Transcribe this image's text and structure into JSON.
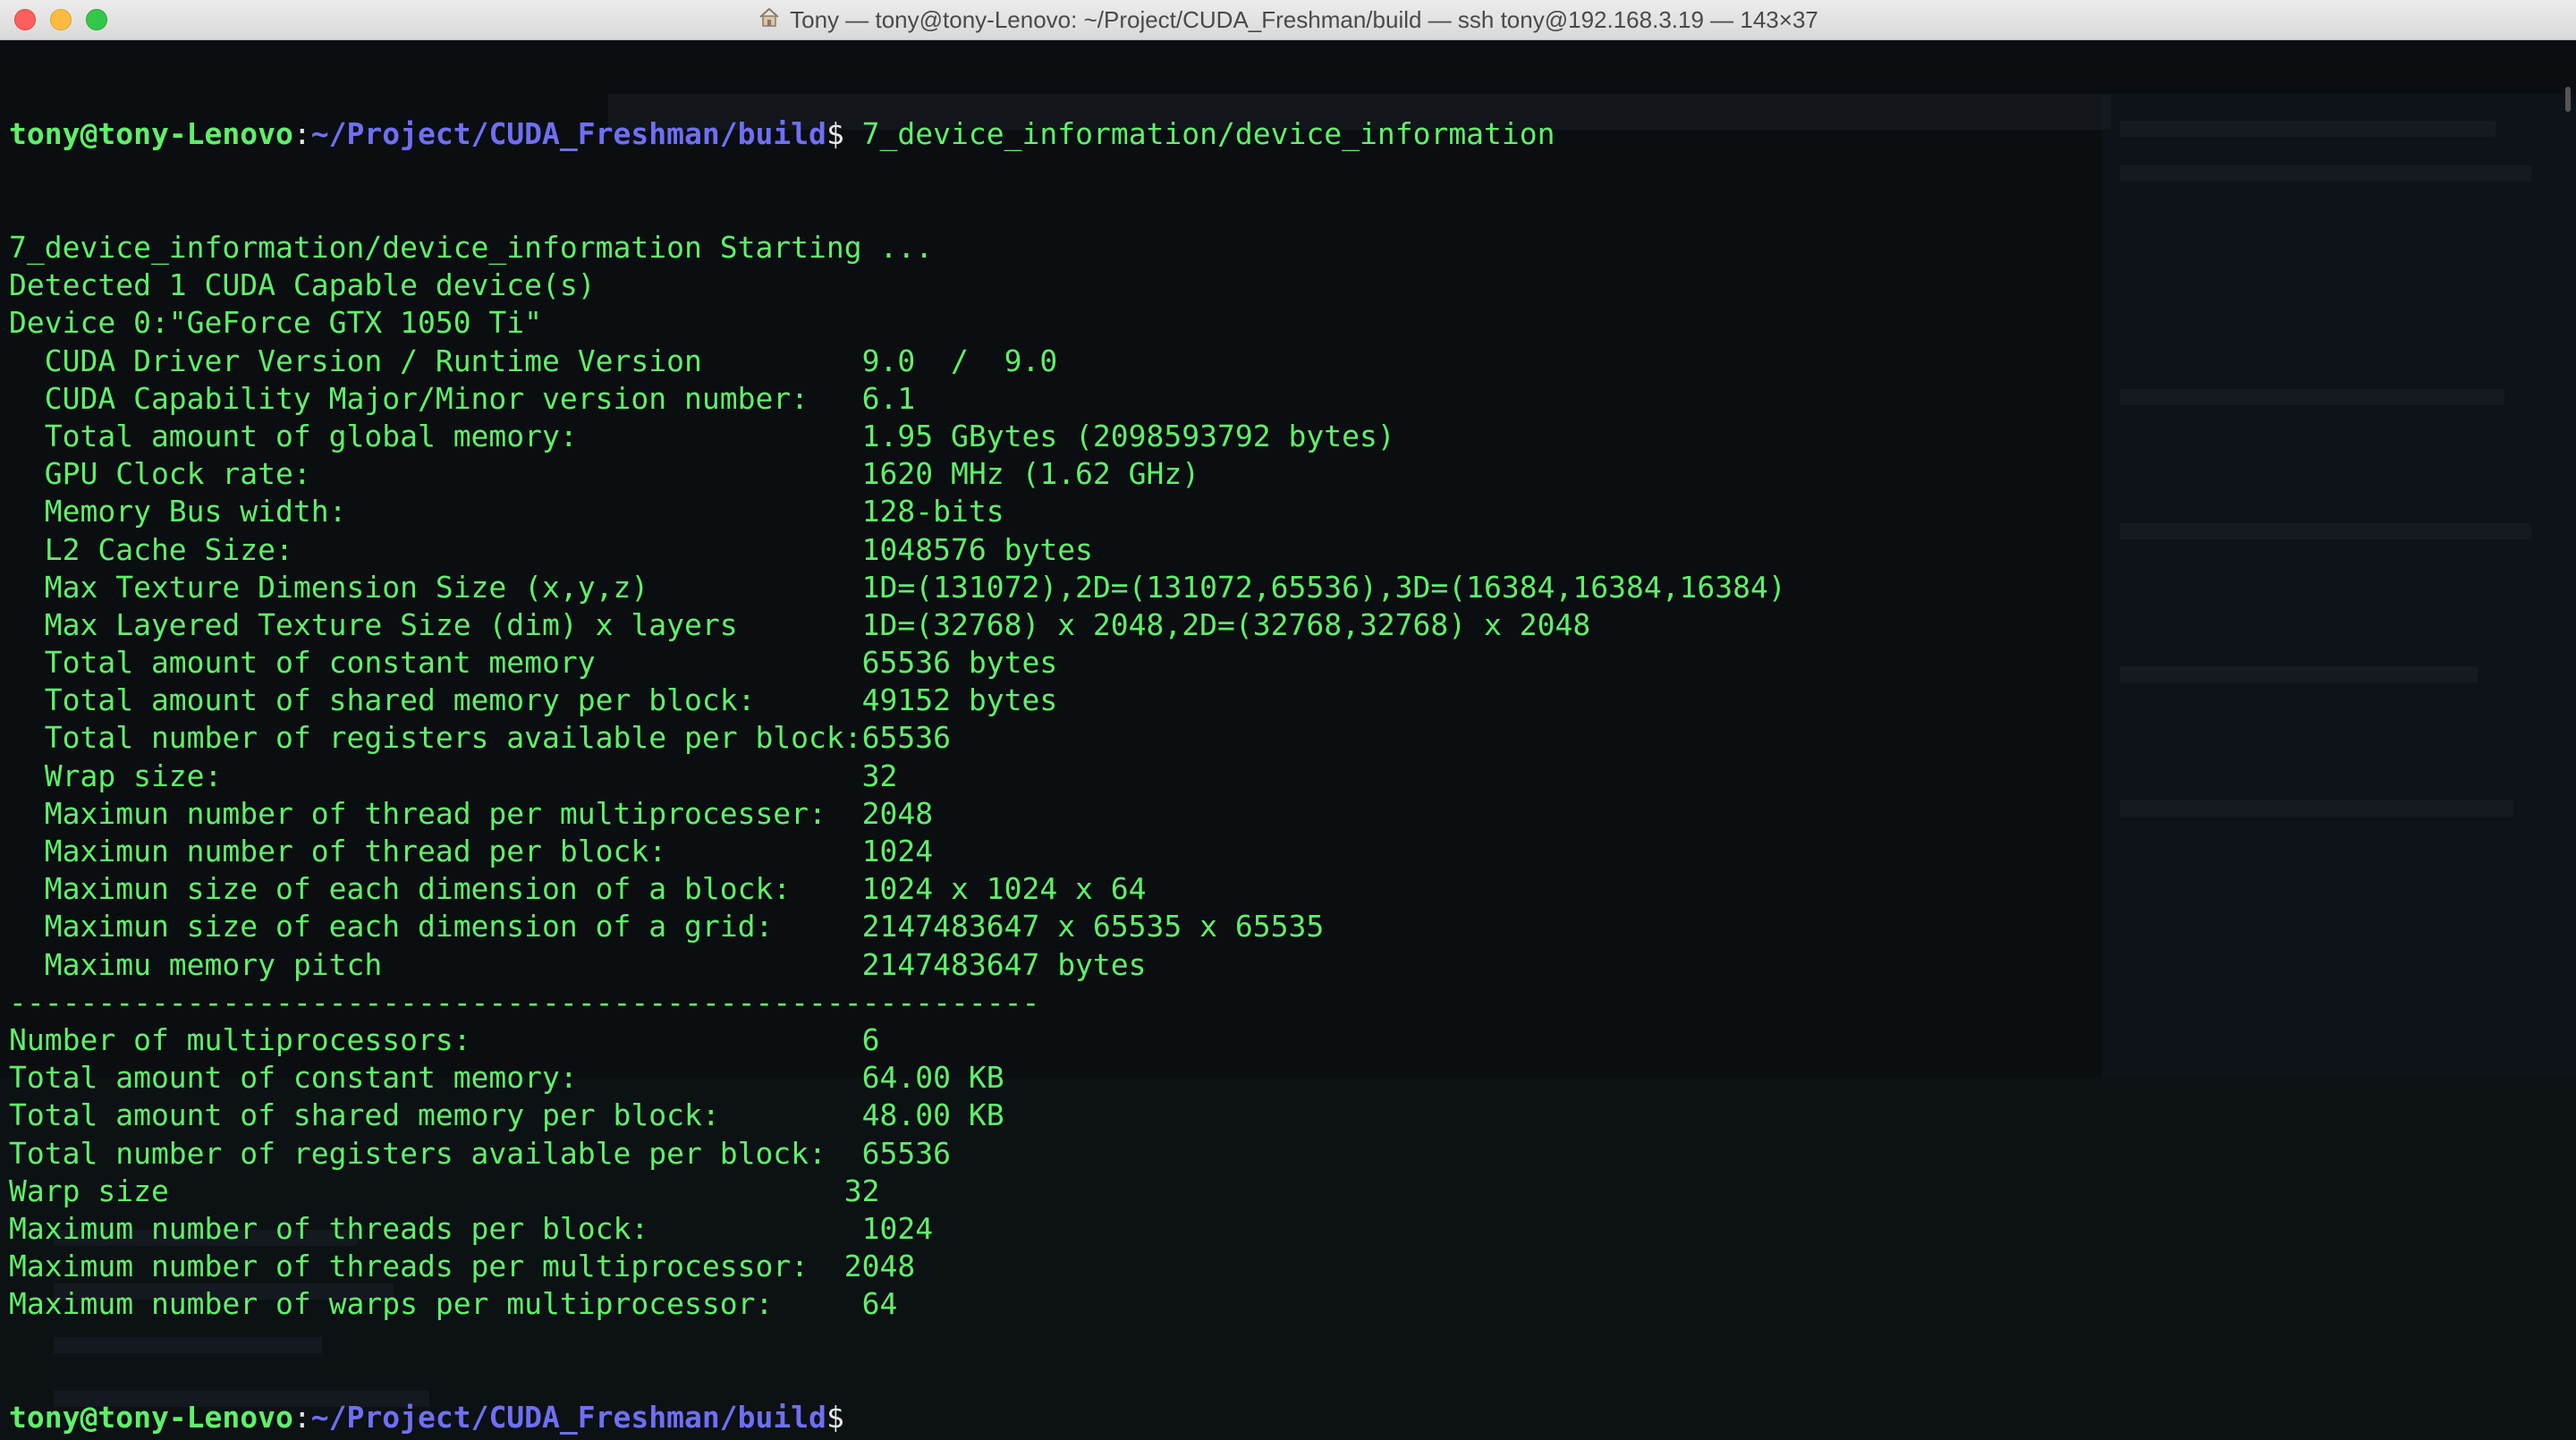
{
  "window": {
    "title": "Tony — tony@tony-Lenovo: ~/Project/CUDA_Freshman/build — ssh tony@192.168.3.19 — 143×37"
  },
  "colors": {
    "text_green": "#5ff06a",
    "path_blue": "#6f6ff5",
    "background": "#0b0e11"
  },
  "prompt": {
    "user_host": "tony@tony-Lenovo",
    "separator": ":",
    "path": "~/Project/CUDA_Freshman/build",
    "symbol": "$"
  },
  "first_command": " 7_device_information/device_information",
  "output_lines": [
    "7_device_information/device_information Starting ...",
    "Detected 1 CUDA Capable device(s)",
    "Device 0:\"GeForce GTX 1050 Ti\"",
    "  CUDA Driver Version / Runtime Version         9.0  /  9.0",
    "  CUDA Capability Major/Minor version number:   6.1",
    "  Total amount of global memory:                1.95 GBytes (2098593792 bytes)",
    "  GPU Clock rate:                               1620 MHz (1.62 GHz)",
    "  Memory Bus width:                             128-bits",
    "  L2 Cache Size:                                1048576 bytes",
    "  Max Texture Dimension Size (x,y,z)            1D=(131072),2D=(131072,65536),3D=(16384,16384,16384)",
    "  Max Layered Texture Size (dim) x layers       1D=(32768) x 2048,2D=(32768,32768) x 2048",
    "  Total amount of constant memory               65536 bytes",
    "  Total amount of shared memory per block:      49152 bytes",
    "  Total number of registers available per block:65536",
    "  Wrap size:                                    32",
    "  Maximun number of thread per multiprocesser:  2048",
    "  Maximun number of thread per block:           1024",
    "  Maximun size of each dimension of a block:    1024 x 1024 x 64",
    "  Maximun size of each dimension of a grid:     2147483647 x 65535 x 65535",
    "  Maximu memory pitch                           2147483647 bytes",
    "----------------------------------------------------------",
    "Number of multiprocessors:                      6",
    "Total amount of constant memory:                64.00 KB",
    "Total amount of shared memory per block:        48.00 KB",
    "Total number of registers available per block:  65536",
    "Warp size                                      32",
    "Maximum number of threads per block:            1024",
    "Maximum number of threads per multiprocessor:  2048",
    "Maximum number of warps per multiprocessor:     64"
  ]
}
